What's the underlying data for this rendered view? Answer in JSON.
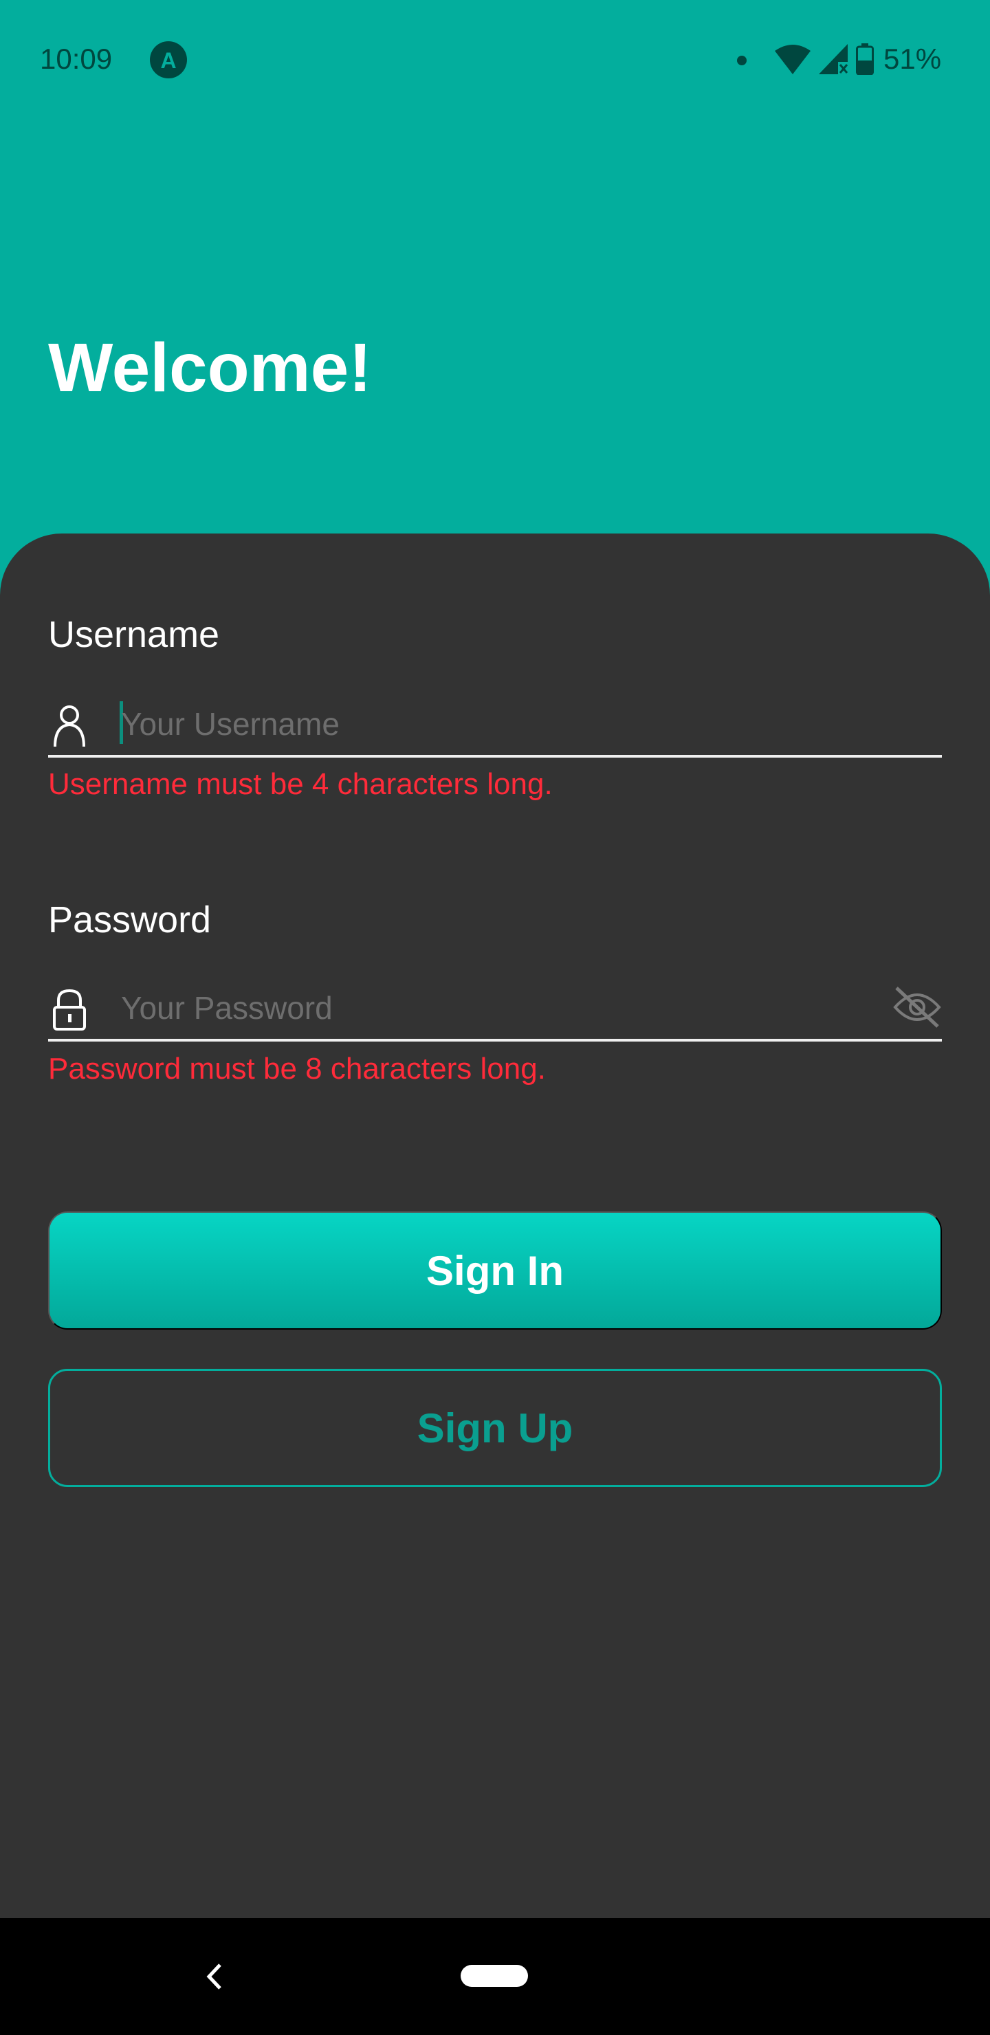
{
  "status_bar": {
    "time": "10:09",
    "app_icon_letter": "A",
    "battery": "51%"
  },
  "header": {
    "title": "Welcome!"
  },
  "form": {
    "username": {
      "label": "Username",
      "placeholder": "Your Username",
      "error": "Username must be 4 characters long."
    },
    "password": {
      "label": "Password",
      "placeholder": "Your Password",
      "error": "Password must be 8 characters long."
    }
  },
  "buttons": {
    "sign_in": "Sign In",
    "sign_up": "Sign Up"
  },
  "colors": {
    "brand": "#03ae9d",
    "surface": "#333333",
    "error": "#ff2b3a"
  }
}
